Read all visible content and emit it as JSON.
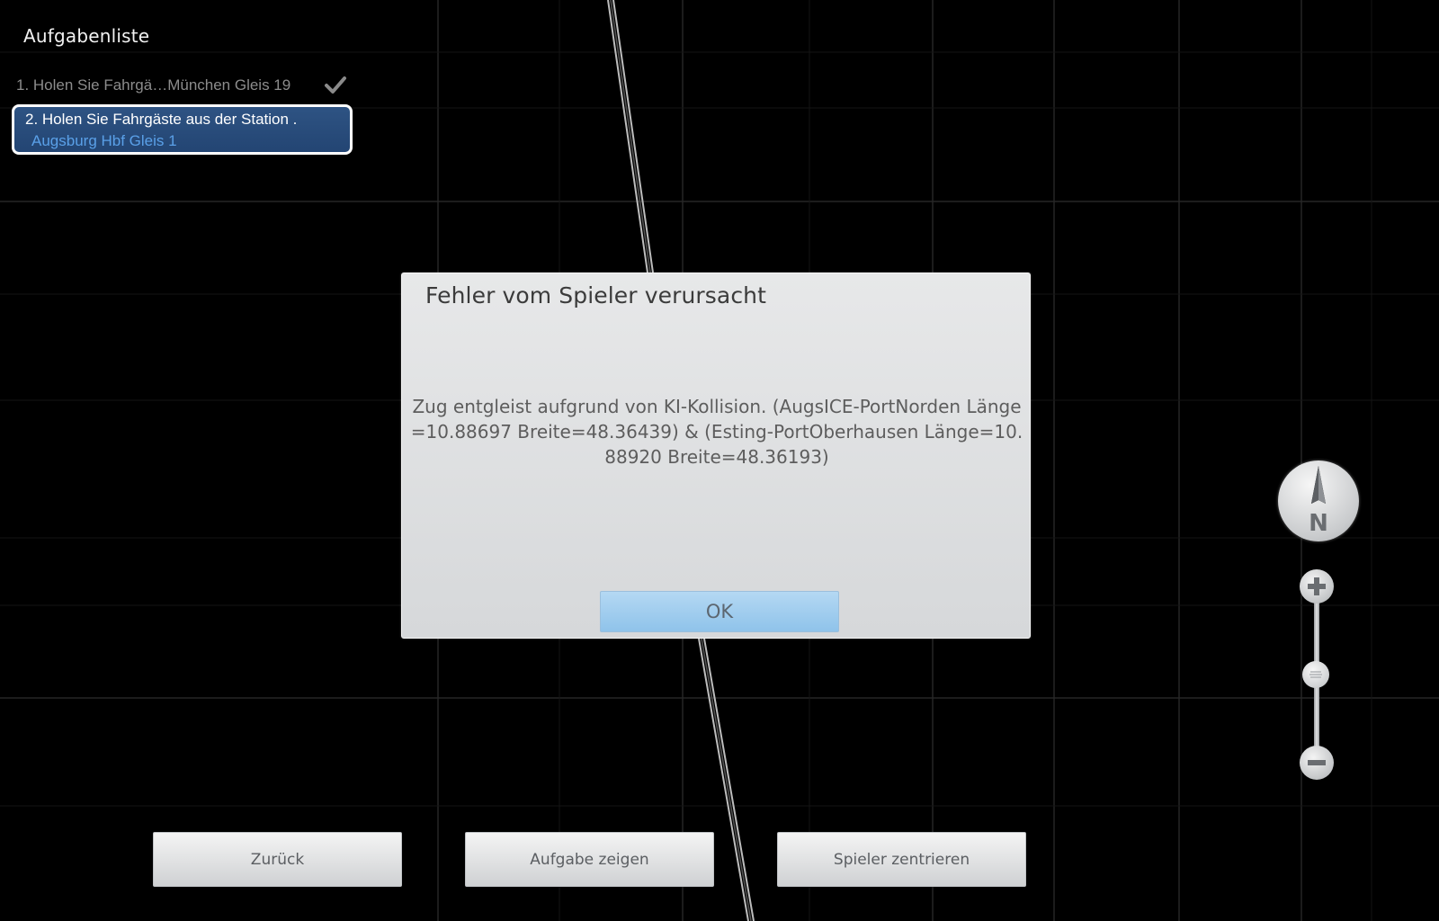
{
  "task_list": {
    "title": "Aufgabenliste",
    "items": [
      {
        "text": "1. Holen Sie Fahrgä…München Gleis 19",
        "status": "done",
        "icon": "checkmark-icon"
      },
      {
        "line1": "2. Holen Sie Fahrgäste aus der Station .",
        "line2": "Augsburg Hbf Gleis 1",
        "status": "active"
      }
    ]
  },
  "dialog": {
    "title": "Fehler vom Spieler verursacht",
    "message": "Zug entgleist aufgrund von KI-Kollision. (AugsICE-PortNorden Länge=10.88697 Breite=48.36439) & (Esting-PortOberhausen Länge=10.88920 Breite=48.36193)",
    "ok_label": "OK"
  },
  "bottom_buttons": {
    "back_label": "Zurück",
    "show_task_label": "Aufgabe zeigen",
    "center_player_label": "Spieler zentrieren"
  },
  "map_controls": {
    "compass_label": "N",
    "zoom_level": 0.5,
    "icons": [
      "compass-icon",
      "zoom-in-icon",
      "zoom-out-icon"
    ]
  },
  "colors": {
    "background": "#000000",
    "grid_line": "#2a2a2a",
    "task_active_bg": "#2e5383",
    "task_active_subtext": "#5aa0e8",
    "ok_button": "#a7d0ef"
  }
}
